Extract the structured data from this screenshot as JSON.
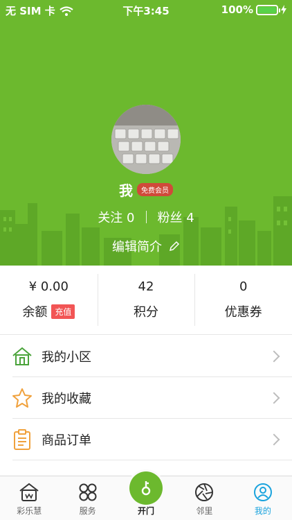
{
  "status": {
    "carrier": "无 SIM 卡",
    "time": "下午3:45",
    "battery": "100%",
    "battery_level": 1.0
  },
  "profile": {
    "name": "我",
    "member_badge": "免费会员",
    "follow_label": "关注",
    "follow_count": "0",
    "fans_label": "粉丝",
    "fans_count": "4",
    "edit_label": "编辑简介"
  },
  "stats": [
    {
      "value": "¥ 0.00",
      "label": "余额",
      "badge": "充值"
    },
    {
      "value": "42",
      "label": "积分"
    },
    {
      "value": "0",
      "label": "优惠券"
    }
  ],
  "menu": [
    {
      "label": "我的小区",
      "icon": "house-icon"
    },
    {
      "label": "我的收藏",
      "icon": "star-icon"
    },
    {
      "label": "商品订单",
      "icon": "clipboard-icon"
    }
  ],
  "tabs": [
    {
      "label": "彩乐慧",
      "icon": "home-icon"
    },
    {
      "label": "服务",
      "icon": "services-icon"
    },
    {
      "label": "开门",
      "icon": "key-icon"
    },
    {
      "label": "邻里",
      "icon": "camera-aperture-icon"
    },
    {
      "label": "我的",
      "icon": "profile-icon",
      "active": true
    }
  ],
  "colors": {
    "brand_green": "#6cb92e",
    "active_blue": "#1aa3dd",
    "badge_red": "#d04a3a",
    "recharge_red": "#f25555"
  }
}
